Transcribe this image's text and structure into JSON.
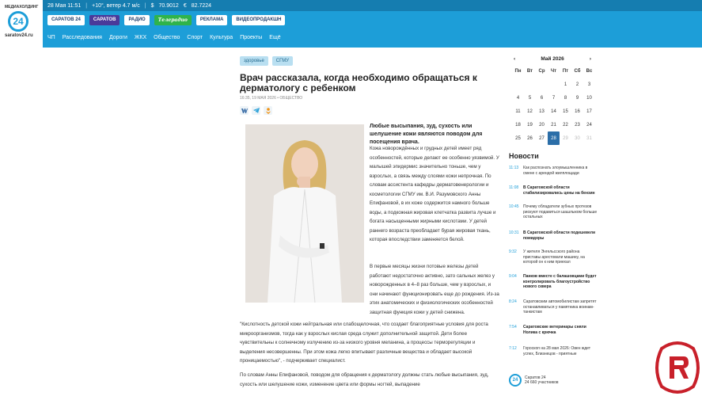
{
  "logo": {
    "small_text": "МЕДИАХОЛДИНГ",
    "number": "24",
    "domain": "saratov24.ru"
  },
  "topstrip": {
    "date": "28 Мая 11:51",
    "weather": "+10°, ветер 4.7 м/с",
    "usd_symbol": "$",
    "usd": "70.9012",
    "eur_symbol": "€",
    "eur": "82.7224"
  },
  "brand_buttons": [
    "САРАТОВ 24",
    "САРАТОВ",
    "РАДИО",
    "Телерадио",
    "РЕКЛАМА",
    "ВИДЕОПРОДАКШН"
  ],
  "nav_items": [
    "ЧП",
    "Расследования",
    "Дороги",
    "ЖКХ",
    "Общество",
    "Спорт",
    "Культура",
    "Проекты",
    "Ещё"
  ],
  "article": {
    "tags": [
      "здоровье",
      "СГМУ"
    ],
    "title": "Врач рассказала, когда необходимо обращаться к дерматологу с ребенком",
    "meta": "16:35, 19 МАЯ 2026 • ОБЩЕСТВО",
    "share_labels": [
      "VK",
      "TG",
      "OK"
    ],
    "lead": "Любые высыпания, зуд, сухость или шелушение кожи являются поводом для посещения врача.",
    "para1": "Кожа новорождённых и грудных детей имеет ряд особенностей, которые делают ее особенно уязвимой. У малышей эпидермис значительно тоньше, чем у взрослых, а связь между слоями кожи непрочная. По словам ассистента кафедры дерматовенерологии и косметологии СГМУ им. В.И. Разумовского Анны Епифановой, в их коже содержится намного больше воды, а подкожная жировая клетчатка развита лучше и богата насыщенными жирными кислотами. У детей раннего возраста преобладает бурая жировая ткань, которая впоследствии заменяется белой.",
    "para2": "В первые месяцы жизни потовые железы детей работают недостаточно активно, зато сальных желез у новорожденных в 4–8 раз больше, чем у взрослых, и они начинают функционировать еще до рождения. Из-за этих анатомических и физиологических особенностей защитная функция кожи у детей снижена.",
    "para3": "\"Кислотность детской кожи нейтральная или слабощелочная, что создает благоприятные условия для роста микроорганизмов, тогда как у взрослых кислая среда служит дополнительной защитой. Дети более чувствительны к солнечному излучению из-за низкого уровня меланина, а процессы терморегуляции и выделения несовершенны. При этом кожа легко впитывает различные вещества и обладает высокой проницаемостью\", - подчеркивает специалист.",
    "para4": "По словам Анны Епифановой, поводом для обращения к дерматологу должны стать любые высыпания, зуд, сухость или шелушение кожи, изменение цвета или формы ногтей, выпадение"
  },
  "calendar": {
    "month": "Май 2026",
    "prev": "‹",
    "next": "›",
    "weekdays": [
      "Пн",
      "Вт",
      "Ср",
      "Чт",
      "Пт",
      "Сб",
      "Вс"
    ],
    "days": [
      "",
      "",
      "",
      "",
      "1",
      "2",
      "3",
      "4",
      "5",
      "6",
      "7",
      "8",
      "9",
      "10",
      "11",
      "12",
      "13",
      "14",
      "15",
      "16",
      "17",
      "18",
      "19",
      "20",
      "21",
      "22",
      "23",
      "24",
      "25",
      "26",
      "27",
      "28",
      "29",
      "30",
      "31"
    ],
    "today": "28"
  },
  "news": {
    "title": "Новости",
    "items": [
      {
        "time": "11:13",
        "text": "Как распознать злоумышленника в смене с арендой жилплощади"
      },
      {
        "time": "11:08",
        "text": "В Саратовской области стабилизировались цены на бензин"
      },
      {
        "time": "10:45",
        "text": "Почему обладатели зубных протезов рискуют подавиться шашлыком больше остальных"
      },
      {
        "time": "10:31",
        "text": "В Саратовской области подешевели помидоры"
      },
      {
        "time": "9:32",
        "text": "У жителя Энгельсского района приставы арестовали машину, на которой он к ним приехал"
      },
      {
        "time": "9:04",
        "text": "Панков вместе с балашовцами будет контролировать благоустройство нового сквера"
      },
      {
        "time": "8:24",
        "text": "Саратовским автомобилистам запретят останавливаться у памятника воинам-танкистам"
      },
      {
        "time": "7:54",
        "text": "Саратовские ветеринары сняли Нолика с крючка"
      },
      {
        "time": "7:12",
        "text": "Гороскоп на 28 мая 2026: Овен ждет успех, Близнецов - приятные"
      }
    ]
  },
  "social": {
    "name": "Саратов 24",
    "members": "24 660 участников"
  }
}
